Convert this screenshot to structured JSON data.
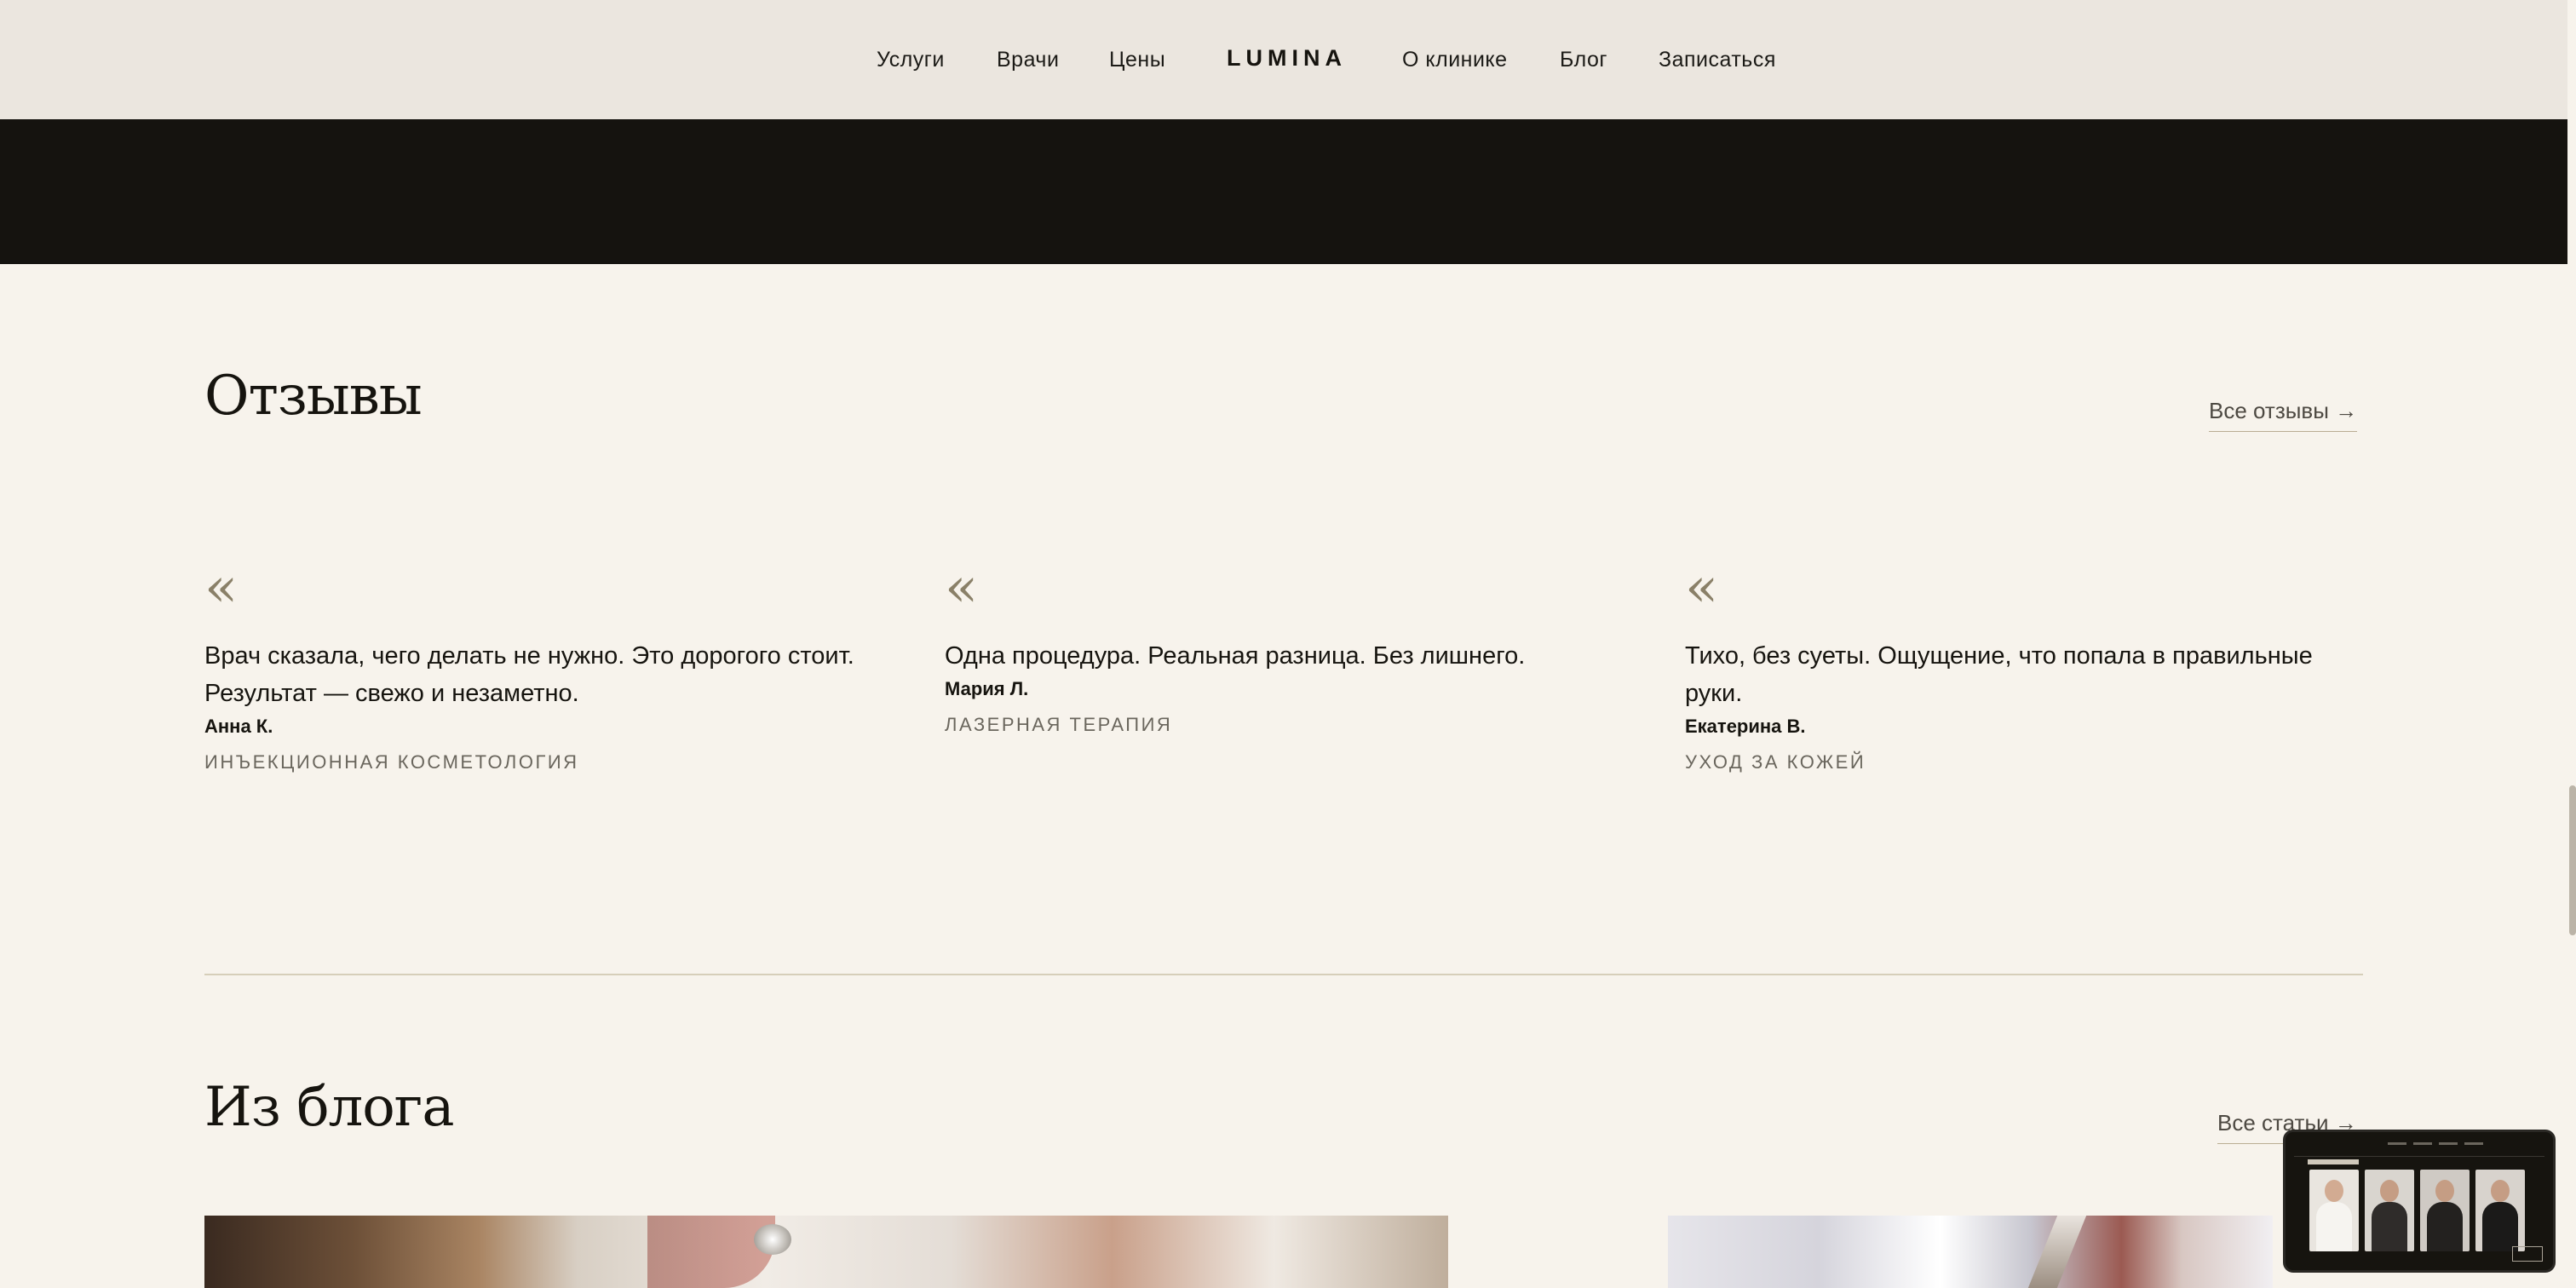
{
  "header": {
    "nav_left": [
      "Услуги",
      "Врачи",
      "Цены"
    ],
    "logo": "LUMINA",
    "nav_right": [
      "О клинике",
      "Блог",
      "Записаться"
    ]
  },
  "reviews_section": {
    "title": "Отзывы",
    "see_all": "Все отзывы →",
    "quote_mark": "«",
    "items": [
      {
        "text": "Врач сказала, чего делать не нужно. Это дорогого стоит. Результат — свежо и незаметно.",
        "author": "Анна К.",
        "service": "ИНЪЕКЦИОННАЯ КОСМЕТОЛОГИЯ"
      },
      {
        "text": "Одна процедура. Реальная разница. Без лишнего.",
        "author": "Мария Л.",
        "service": "ЛАЗЕРНАЯ ТЕРАПИЯ"
      },
      {
        "text": "Тихо, без суеты. Ощущение, что попала в правильные руки.",
        "author": "Екатерина В.",
        "service": "УХОД ЗА КОЖЕЙ"
      }
    ]
  },
  "blog_section": {
    "title": "Из блога",
    "see_all": "Все статьи →"
  },
  "colors": {
    "background": "#f7f3ec",
    "header": "#ebe6df",
    "dark_band": "#15130f",
    "accent_line": "#b9ad93"
  }
}
